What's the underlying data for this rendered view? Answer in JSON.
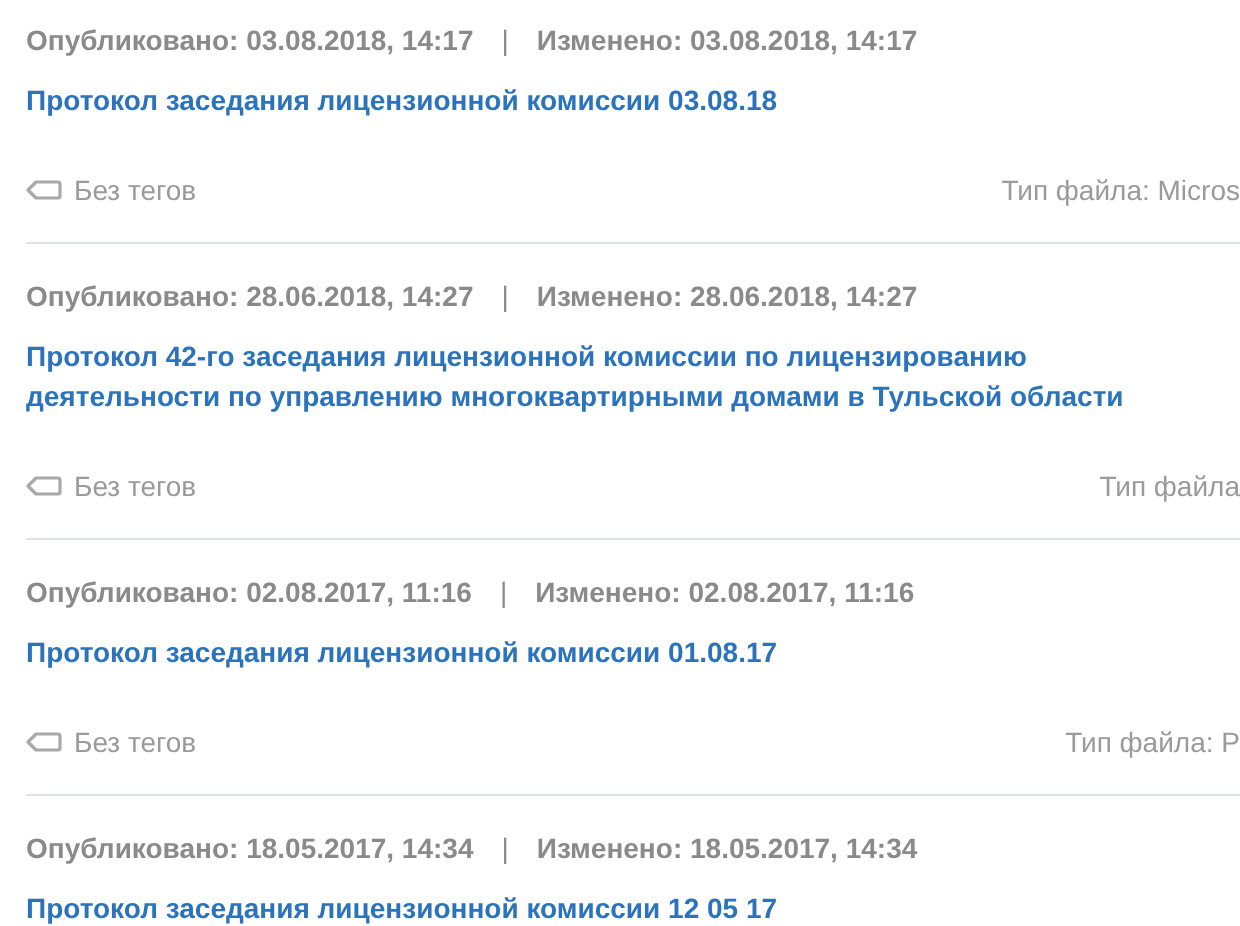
{
  "documents": [
    {
      "published": "Опубликовано: 03.08.2018, 14:17",
      "separator": "|",
      "modified": "Изменено: 03.08.2018, 14:17",
      "title": "Протокол заседания лицензионной комиссии 03.08.18",
      "tags": "Без тегов",
      "file_type": "Тип файла: Micros"
    },
    {
      "published": "Опубликовано: 28.06.2018, 14:27",
      "separator": "|",
      "modified": "Изменено: 28.06.2018, 14:27",
      "title": "Протокол 42-го заседания лицензионной комиссии по лицензированию деятельности по управлению многоквартирными домами в Тульской области",
      "tags": "Без тегов",
      "file_type": "Тип файла"
    },
    {
      "published": "Опубликовано: 02.08.2017, 11:16",
      "separator": "|",
      "modified": "Изменено: 02.08.2017, 11:16",
      "title": "Протокол заседания лицензионной комиссии 01.08.17",
      "tags": "Без тегов",
      "file_type": "Тип файла: P"
    },
    {
      "published": "Опубликовано: 18.05.2017, 14:34",
      "separator": "|",
      "modified": "Изменено: 18.05.2017, 14:34",
      "title": "Протокол заседания лицензионной комиссии 12 05 17"
    }
  ]
}
